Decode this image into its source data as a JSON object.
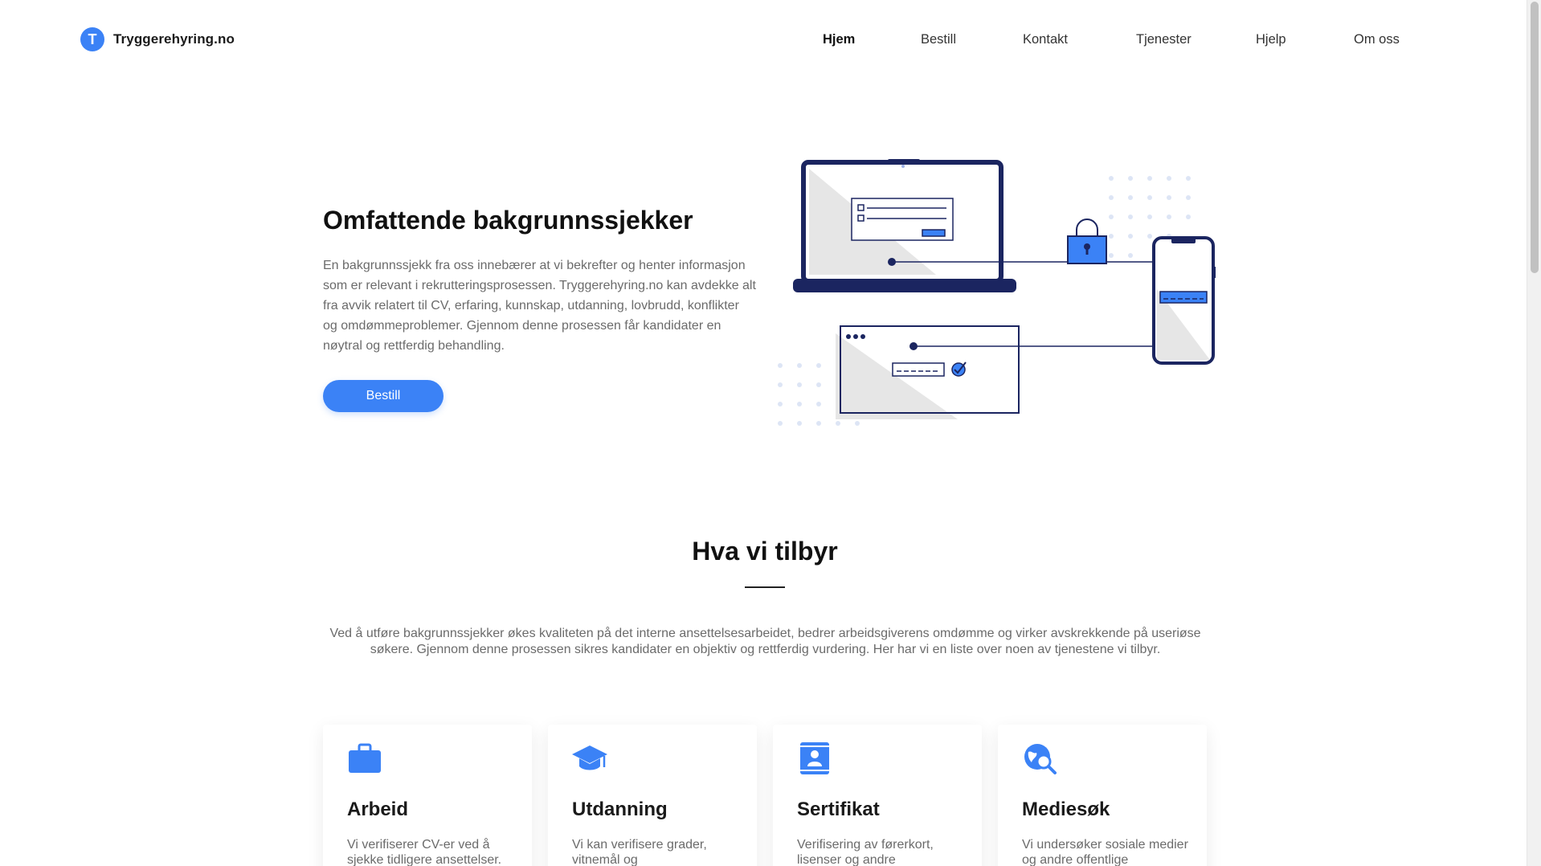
{
  "brand": {
    "logo_letter": "T",
    "name": "Tryggerehyring.no"
  },
  "nav": {
    "items": [
      {
        "label": "Hjem",
        "active": true
      },
      {
        "label": "Bestill"
      },
      {
        "label": "Kontakt"
      },
      {
        "label": "Tjenester"
      },
      {
        "label": "Hjelp"
      },
      {
        "label": "Om oss"
      }
    ]
  },
  "hero": {
    "title": "Omfattende bakgrunnssjekker",
    "text": "En bakgrunnssjekk fra oss innebærer at vi bekrefter og henter informasjon som er relevant i rekrutteringsprosessen. Tryggerehyring.no kan avdekke alt fra avvik relatert til CV, erfaring, kunnskap, utdanning, lovbrudd, konflikter og omdømmeproblemer. Gjennom denne prosessen får kandidater en nøytral og rettferdig behandling.",
    "button_label": "Bestill"
  },
  "offer": {
    "title": "Hva vi tilbyr",
    "text": "Ved å utføre bakgrunnssjekker økes kvaliteten på det interne ansettelsesarbeidet, bedrer arbeidsgiverens omdømme og virker avskrekkende på useriøse søkere. Gjennom denne prosessen sikres kandidater en objektiv og rettferdig vurdering. Her har vi en liste over noen av tjenestene vi tilbyr.",
    "cards": [
      {
        "icon": "briefcase-icon",
        "title": "Arbeid",
        "text": "Vi verifiserer CV-er ved å sjekke tidligere ansettelser."
      },
      {
        "icon": "graduation-cap-icon",
        "title": "Utdanning",
        "text": "Vi kan verifisere grader, vitnemål og"
      },
      {
        "icon": "id-card-icon",
        "title": "Sertifikat",
        "text": "Verifisering av førerkort, lisenser og andre"
      },
      {
        "icon": "globe-search-icon",
        "title": "Mediesøk",
        "text": "Vi undersøker sosiale medier og andre offentlige"
      }
    ]
  },
  "colors": {
    "accent": "#3b82f6",
    "navy": "#1b2560",
    "text_muted": "#6b6b6b"
  }
}
